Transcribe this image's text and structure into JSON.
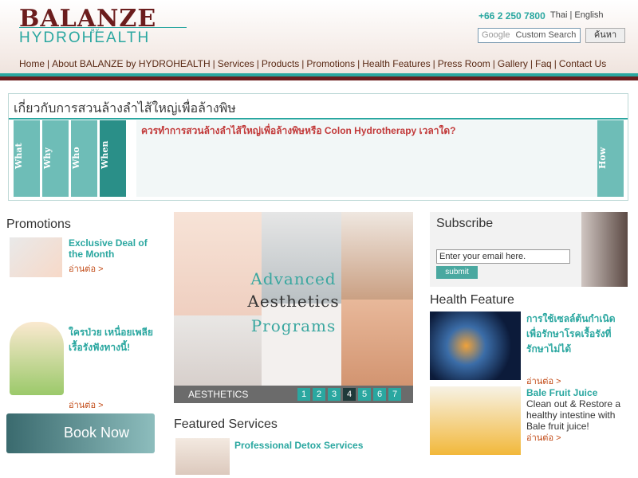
{
  "header": {
    "logo_main": "BALANZE",
    "logo_by": "BY",
    "logo_sub": "HYDROHEALTH",
    "phone": "+66 2 250 7800",
    "lang_thai": "Thai",
    "lang_sep": "|",
    "lang_english": "English",
    "search_brand": "Google",
    "search_placeholder": "Custom Search",
    "search_button": "ค้นหา"
  },
  "nav": [
    "Home",
    "About BALANZE by HYDROHEALTH",
    "Services",
    "Products",
    "Promotions",
    "Health Features",
    "Press Room",
    "Gallery",
    "Faq",
    "Contact Us"
  ],
  "about": {
    "title": "เกี่ยวกับการสวนล้างลำไส้ใหญ่เพื่อล้างพิษ",
    "tabs": [
      "What",
      "Why",
      "Who",
      "When"
    ],
    "tab_right": "How",
    "question": "ควรทำการสวนล้างลำไส้ใหญ่เพื่อล้างพิษหรือ Colon Hydrotherapy เวลาใด?"
  },
  "promotions": {
    "title": "Promotions",
    "item1_title": "Exclusive Deal of the Month",
    "item2_title": "ใครป่วย เหนื่อยเพลีย เรื้อรังฟังทางนี้!",
    "more_label": "อ่านต่อ >",
    "book_now": "Book Now"
  },
  "banner": {
    "word1": "Advanced",
    "word2": "Aesthetics",
    "word3": "Programs",
    "label": "AESTHETICS",
    "pages": [
      "1",
      "2",
      "3",
      "4",
      "5",
      "6",
      "7"
    ],
    "active_page": 4
  },
  "featured": {
    "title": "Featured Services",
    "item_title": "Professional Detox Services"
  },
  "subscribe": {
    "title": "Subscribe",
    "input_value": "Enter your email here.",
    "button": "submit"
  },
  "health_feature": {
    "title": "Health Feature",
    "item1_title": "การใช้เซลล์ต้นกำเนิดเพื่อรักษาโรคเรื้อรังที่รักษาไม่ได้",
    "item2_title": "Bale Fruit Juice",
    "item2_body": "Clean out & Restore a healthy intestine with Bale fruit juice!",
    "more_label": "อ่านต่อ >"
  },
  "colors": {
    "brand_maroon": "#6b1d1d",
    "brand_teal": "#2aa7a0",
    "link_orange": "#c24a16"
  }
}
